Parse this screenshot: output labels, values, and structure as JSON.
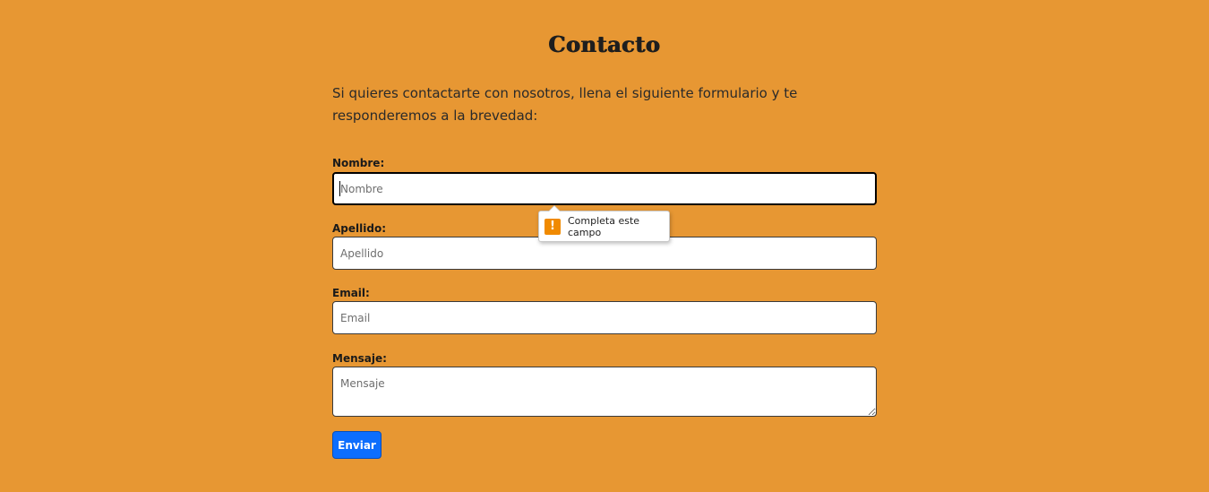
{
  "page": {
    "title": "Contacto",
    "intro": "Si quieres contactarte con nosotros, llena el siguiente formulario y te responderemos a la brevedad:"
  },
  "form": {
    "nombre": {
      "label": "Nombre:",
      "placeholder": "Nombre",
      "value": ""
    },
    "apellido": {
      "label": "Apellido:",
      "placeholder": "Apellido",
      "value": ""
    },
    "email": {
      "label": "Email:",
      "placeholder": "Email",
      "value": ""
    },
    "mensaje": {
      "label": "Mensaje:",
      "placeholder": "Mensaje",
      "value": ""
    },
    "submit_label": "Enviar"
  },
  "validation_tooltip": {
    "icon": "warning-icon",
    "icon_glyph": "!",
    "message": "Completa este campo"
  },
  "colors": {
    "background": "#e79733",
    "button": "#0d6efd",
    "warning": "#f08a00"
  }
}
